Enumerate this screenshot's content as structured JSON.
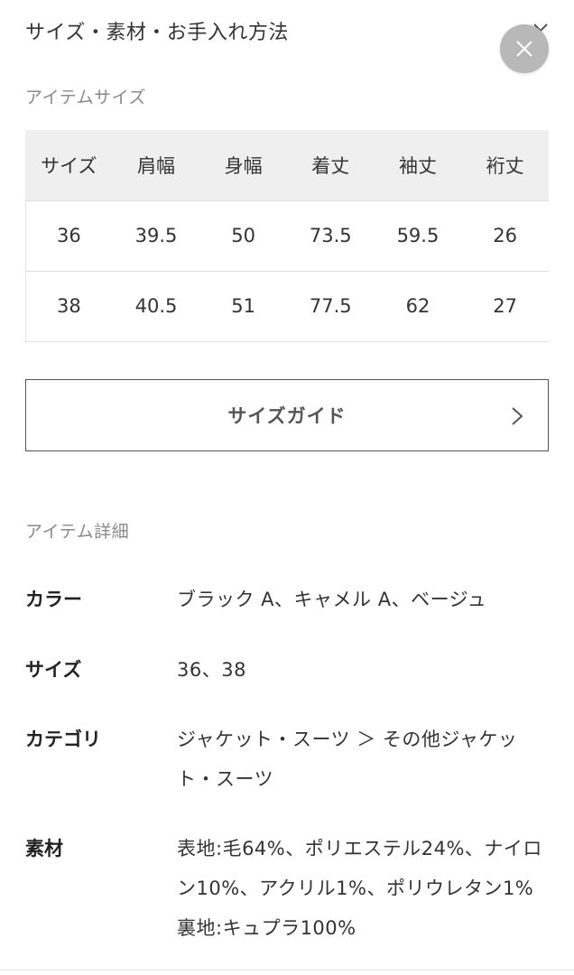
{
  "header": {
    "title": "サイズ・素材・お手入れ方法",
    "collapse_icon": "chevron-down-icon",
    "close_icon": "close-icon"
  },
  "size_section": {
    "label": "アイテムサイズ",
    "columns": [
      "サイズ",
      "肩幅",
      "身幅",
      "着丈",
      "袖丈",
      "裄丈"
    ],
    "rows": [
      [
        "36",
        "39.5",
        "50",
        "73.5",
        "59.5",
        "26"
      ],
      [
        "38",
        "40.5",
        "51",
        "77.5",
        "62",
        "27"
      ]
    ]
  },
  "size_guide": {
    "label": "サイズガイド",
    "icon": "chevron-right-icon"
  },
  "detail_section": {
    "label": "アイテム詳細",
    "items": [
      {
        "key": "カラー",
        "value": "ブラック A、キャメル A、ベージュ"
      },
      {
        "key": "サイズ",
        "value": "36、38"
      },
      {
        "key": "カテゴリ",
        "value": "ジャケット・スーツ ＞ その他ジャケット・スーツ"
      },
      {
        "key": "素材",
        "value": "表地:毛64%、ポリエステル24%、ナイロン10%、アクリル1%、ポリウレタン1% 裏地:キュプラ100%"
      }
    ]
  },
  "colors": {
    "header_background": "#efefef",
    "close_button": "#b8b8b8",
    "border": "#555555",
    "muted_text": "#8a8a8a"
  }
}
